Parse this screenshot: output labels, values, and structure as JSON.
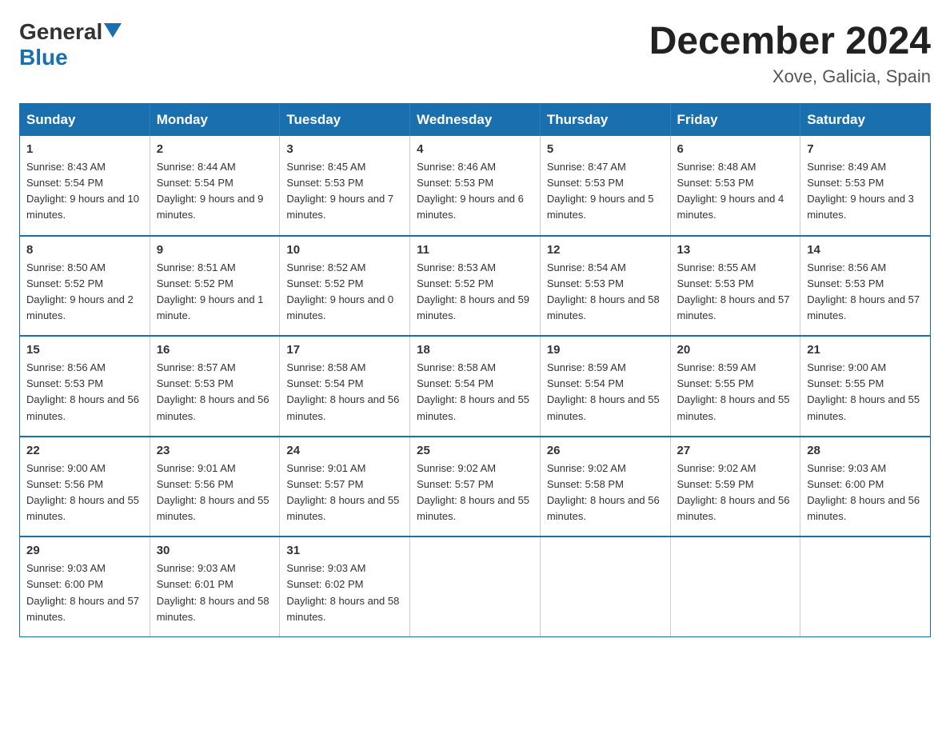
{
  "header": {
    "logo_general": "General",
    "logo_blue": "Blue",
    "month_title": "December 2024",
    "location": "Xove, Galicia, Spain"
  },
  "days_of_week": [
    "Sunday",
    "Monday",
    "Tuesday",
    "Wednesday",
    "Thursday",
    "Friday",
    "Saturday"
  ],
  "weeks": [
    [
      {
        "day": "1",
        "sunrise": "8:43 AM",
        "sunset": "5:54 PM",
        "daylight": "9 hours and 10 minutes."
      },
      {
        "day": "2",
        "sunrise": "8:44 AM",
        "sunset": "5:54 PM",
        "daylight": "9 hours and 9 minutes."
      },
      {
        "day": "3",
        "sunrise": "8:45 AM",
        "sunset": "5:53 PM",
        "daylight": "9 hours and 7 minutes."
      },
      {
        "day": "4",
        "sunrise": "8:46 AM",
        "sunset": "5:53 PM",
        "daylight": "9 hours and 6 minutes."
      },
      {
        "day": "5",
        "sunrise": "8:47 AM",
        "sunset": "5:53 PM",
        "daylight": "9 hours and 5 minutes."
      },
      {
        "day": "6",
        "sunrise": "8:48 AM",
        "sunset": "5:53 PM",
        "daylight": "9 hours and 4 minutes."
      },
      {
        "day": "7",
        "sunrise": "8:49 AM",
        "sunset": "5:53 PM",
        "daylight": "9 hours and 3 minutes."
      }
    ],
    [
      {
        "day": "8",
        "sunrise": "8:50 AM",
        "sunset": "5:52 PM",
        "daylight": "9 hours and 2 minutes."
      },
      {
        "day": "9",
        "sunrise": "8:51 AM",
        "sunset": "5:52 PM",
        "daylight": "9 hours and 1 minute."
      },
      {
        "day": "10",
        "sunrise": "8:52 AM",
        "sunset": "5:52 PM",
        "daylight": "9 hours and 0 minutes."
      },
      {
        "day": "11",
        "sunrise": "8:53 AM",
        "sunset": "5:52 PM",
        "daylight": "8 hours and 59 minutes."
      },
      {
        "day": "12",
        "sunrise": "8:54 AM",
        "sunset": "5:53 PM",
        "daylight": "8 hours and 58 minutes."
      },
      {
        "day": "13",
        "sunrise": "8:55 AM",
        "sunset": "5:53 PM",
        "daylight": "8 hours and 57 minutes."
      },
      {
        "day": "14",
        "sunrise": "8:56 AM",
        "sunset": "5:53 PM",
        "daylight": "8 hours and 57 minutes."
      }
    ],
    [
      {
        "day": "15",
        "sunrise": "8:56 AM",
        "sunset": "5:53 PM",
        "daylight": "8 hours and 56 minutes."
      },
      {
        "day": "16",
        "sunrise": "8:57 AM",
        "sunset": "5:53 PM",
        "daylight": "8 hours and 56 minutes."
      },
      {
        "day": "17",
        "sunrise": "8:58 AM",
        "sunset": "5:54 PM",
        "daylight": "8 hours and 56 minutes."
      },
      {
        "day": "18",
        "sunrise": "8:58 AM",
        "sunset": "5:54 PM",
        "daylight": "8 hours and 55 minutes."
      },
      {
        "day": "19",
        "sunrise": "8:59 AM",
        "sunset": "5:54 PM",
        "daylight": "8 hours and 55 minutes."
      },
      {
        "day": "20",
        "sunrise": "8:59 AM",
        "sunset": "5:55 PM",
        "daylight": "8 hours and 55 minutes."
      },
      {
        "day": "21",
        "sunrise": "9:00 AM",
        "sunset": "5:55 PM",
        "daylight": "8 hours and 55 minutes."
      }
    ],
    [
      {
        "day": "22",
        "sunrise": "9:00 AM",
        "sunset": "5:56 PM",
        "daylight": "8 hours and 55 minutes."
      },
      {
        "day": "23",
        "sunrise": "9:01 AM",
        "sunset": "5:56 PM",
        "daylight": "8 hours and 55 minutes."
      },
      {
        "day": "24",
        "sunrise": "9:01 AM",
        "sunset": "5:57 PM",
        "daylight": "8 hours and 55 minutes."
      },
      {
        "day": "25",
        "sunrise": "9:02 AM",
        "sunset": "5:57 PM",
        "daylight": "8 hours and 55 minutes."
      },
      {
        "day": "26",
        "sunrise": "9:02 AM",
        "sunset": "5:58 PM",
        "daylight": "8 hours and 56 minutes."
      },
      {
        "day": "27",
        "sunrise": "9:02 AM",
        "sunset": "5:59 PM",
        "daylight": "8 hours and 56 minutes."
      },
      {
        "day": "28",
        "sunrise": "9:03 AM",
        "sunset": "6:00 PM",
        "daylight": "8 hours and 56 minutes."
      }
    ],
    [
      {
        "day": "29",
        "sunrise": "9:03 AM",
        "sunset": "6:00 PM",
        "daylight": "8 hours and 57 minutes."
      },
      {
        "day": "30",
        "sunrise": "9:03 AM",
        "sunset": "6:01 PM",
        "daylight": "8 hours and 58 minutes."
      },
      {
        "day": "31",
        "sunrise": "9:03 AM",
        "sunset": "6:02 PM",
        "daylight": "8 hours and 58 minutes."
      },
      null,
      null,
      null,
      null
    ]
  ],
  "labels": {
    "sunrise": "Sunrise:",
    "sunset": "Sunset:",
    "daylight": "Daylight:"
  }
}
